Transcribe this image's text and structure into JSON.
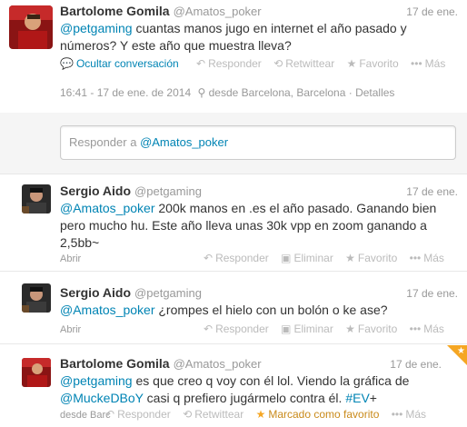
{
  "tweet1": {
    "name": "Bartolome Gomila",
    "handle": "@Amatos_poker",
    "time": "17 de ene.",
    "mention": "@petgaming",
    "text_line1_rest": " cuantas manos jugo en internet el año pasado y",
    "text_line2": "números? Y este año que muestra lleva?",
    "hide_conv": "Ocultar conversación",
    "reply": "Responder",
    "retweet": "Retwittear",
    "favorite": "Favorito",
    "more": "Más",
    "timestamp": "16:41 - 17 de ene. de 2014",
    "location": "desde Barcelona, Barcelona",
    "details": "Detalles"
  },
  "reply_box": {
    "prefix": "Responder a ",
    "mention": "@Amatos_poker"
  },
  "tweet2": {
    "name": "Sergio Aido",
    "handle": "@petgaming",
    "time": "17 de ene.",
    "mention": "@Amatos_poker",
    "line1_rest": " 200k manos en .es el año pasado. Ganando bien",
    "line2": "pero mucho hu. Este año lleva unas 30k vpp en zoom ganando a",
    "line3": "2,5bb~",
    "open": "Abrir",
    "reply": "Responder",
    "delete": "Eliminar",
    "favorite": "Favorito",
    "more": "Más"
  },
  "tweet3": {
    "name": "Sergio Aido",
    "handle": "@petgaming",
    "time": "17 de ene.",
    "mention": "@Amatos_poker",
    "text_rest": " ¿rompes el hielo con un bolón o ke ase?",
    "open": "Abrir",
    "reply": "Responder",
    "delete": "Eliminar",
    "favorite": "Favorito",
    "more": "Más"
  },
  "tweet4": {
    "name": "Bartolome Gomila",
    "handle": "@Amatos_poker",
    "time": "17 de ene.",
    "mention": "@petgaming",
    "line1_rest": " es que creo q voy con él lol.  Viendo la gráfica de",
    "mention2": "@MuckeDBoY",
    "line2_mid": " casi q prefiero jugármelo contra él. ",
    "hashtag": "#EV",
    "line2_end": "+",
    "location_short": "desde Barc",
    "reply": "Responder",
    "retweet": "Retwittear",
    "favorited": "Marcado como favorito",
    "more": "Más"
  },
  "colors": {
    "link": "#0084b4",
    "favorite": "#f5a623",
    "muted": "#999999"
  },
  "icons": [
    "reply-icon",
    "retweet-icon",
    "star-icon",
    "more-icon",
    "location-icon",
    "conversation-icon"
  ]
}
